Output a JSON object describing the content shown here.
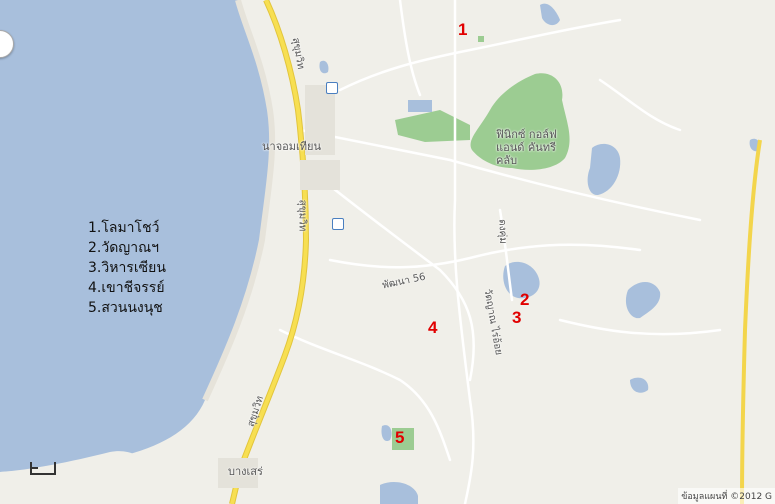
{
  "legend": {
    "items": [
      "1.โลมาโชว์",
      "2.วัดญาณฯ",
      "3.วิหารเซียน",
      "4.เขาชีจรรย์",
      "5.สวนนงนุช"
    ]
  },
  "markers": [
    "1",
    "2",
    "3",
    "4",
    "5"
  ],
  "places": {
    "golf": "ฟินิกซ์ กอล์ฟ แอนด์ คันทรี คลับ",
    "na_jomtien": "นาจอมเทียน",
    "bang_sare": "บางเสร่"
  },
  "roads": {
    "sukhumvit_top": "สุขุมวิท",
    "sukhumvit_mid": "สุขุมวิท",
    "sukhumvit_bottom": "สุขุมวิท",
    "phatthana56": "พัฒนา 56",
    "wat_yan_rai_oi": "วัดญาณ ไร่อ้อย",
    "east_road": "ดงคุ่ม"
  },
  "attribution": "ข้อมูลแผนที่ ©2012 G",
  "colors": {
    "sea": "#a8bfdc",
    "land": "#f0efe9",
    "park": "#9ccc92",
    "water": "#a8bfdc",
    "highway": "#f7df52",
    "marker": "#e10000"
  }
}
